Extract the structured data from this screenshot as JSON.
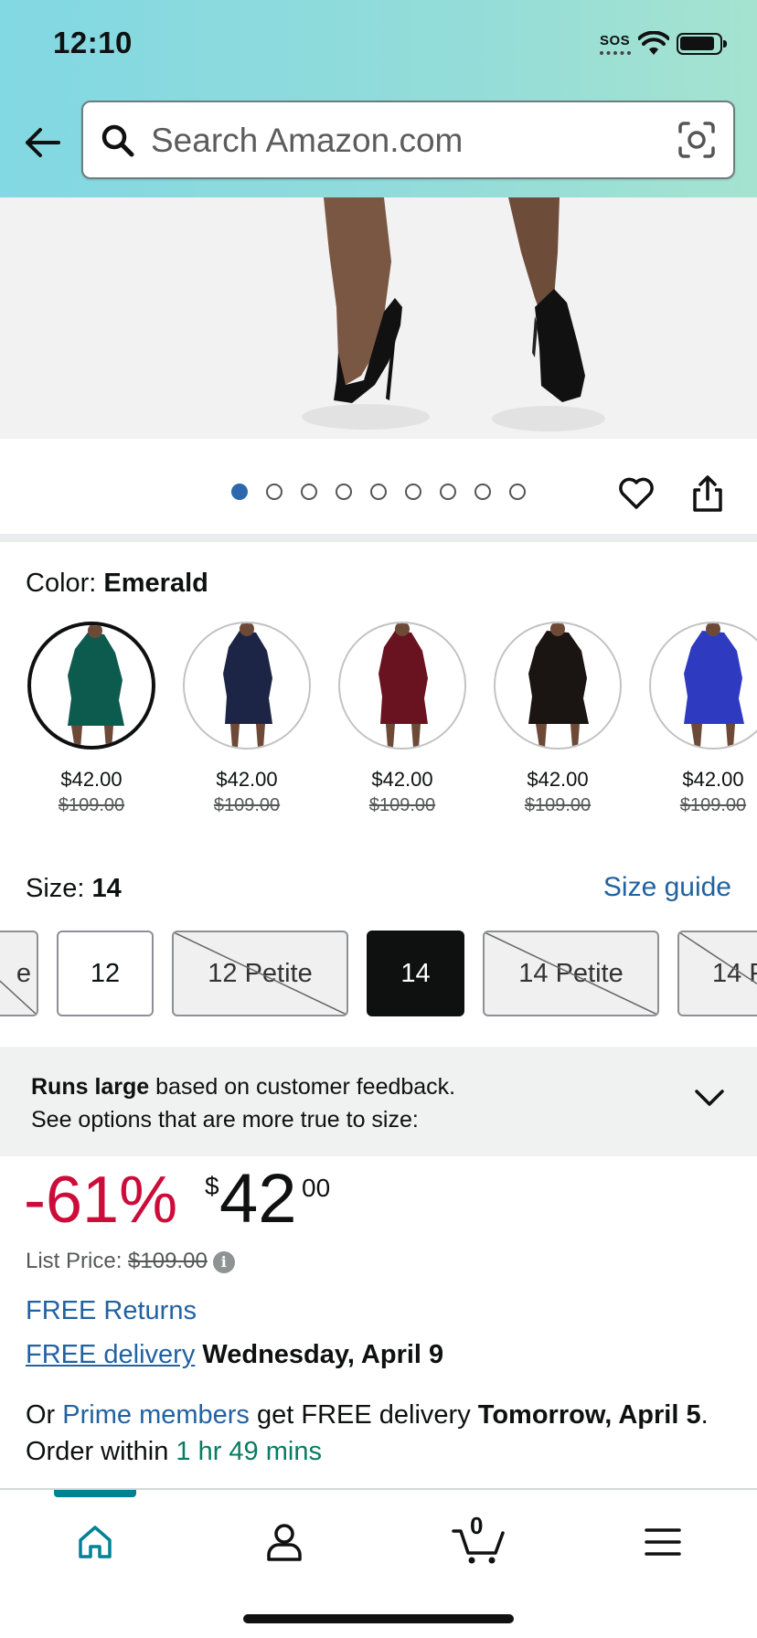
{
  "status_bar": {
    "time": "12:10",
    "sos": "SOS"
  },
  "search": {
    "placeholder": "Search Amazon.com"
  },
  "gallery": {
    "image_count": 9,
    "active_index": 0
  },
  "color": {
    "label": "Color: ",
    "value": "Emerald"
  },
  "swatches": [
    {
      "name": "Emerald",
      "price": "$42.00",
      "was": "$109.00",
      "color": "#0d5b4f"
    },
    {
      "name": "Navy",
      "price": "$42.00",
      "was": "$109.00",
      "color": "#1c2545"
    },
    {
      "name": "Burgundy",
      "price": "$42.00",
      "was": "$109.00",
      "color": "#6a1320"
    },
    {
      "name": "Black",
      "price": "$42.00",
      "was": "$109.00",
      "color": "#1a1412"
    },
    {
      "name": "Cobalt",
      "price": "$42.00",
      "was": "$109.00",
      "color": "#2e3bc0"
    }
  ],
  "size": {
    "label": "Size: ",
    "value": "14",
    "guide": "Size guide",
    "options": [
      {
        "label": "e",
        "state": "unavailable"
      },
      {
        "label": "12",
        "state": "available"
      },
      {
        "label": "12 Petite",
        "state": "unavailable"
      },
      {
        "label": "14",
        "state": "selected"
      },
      {
        "label": "14 Petite",
        "state": "unavailable"
      },
      {
        "label": "14 P",
        "state": "unavailable"
      }
    ]
  },
  "fit": {
    "bold": "Runs large",
    "text1": " based on customer feedback.",
    "text2": "See options that are more true to size:"
  },
  "price": {
    "discount": "-61%",
    "currency": "$",
    "whole": "42",
    "fraction": "00",
    "list_label": "List Price: ",
    "list_value": "$109.00",
    "info": "i"
  },
  "returns": "FREE Returns",
  "delivery": {
    "link": "FREE delivery",
    "date": "Wednesday, April 9"
  },
  "prime": {
    "pre": "Or ",
    "link": "Prime members",
    "mid": " get FREE delivery ",
    "date": "Tomorrow, April 5",
    "post": ".",
    "order_pre": "Order within ",
    "countdown": "1 hr 49 mins"
  },
  "nav": {
    "cart_count": "0"
  },
  "colors": {
    "accent_blue": "#2162a1",
    "deal_red": "#cc0c39",
    "teal": "#008296",
    "green": "#067d62"
  }
}
